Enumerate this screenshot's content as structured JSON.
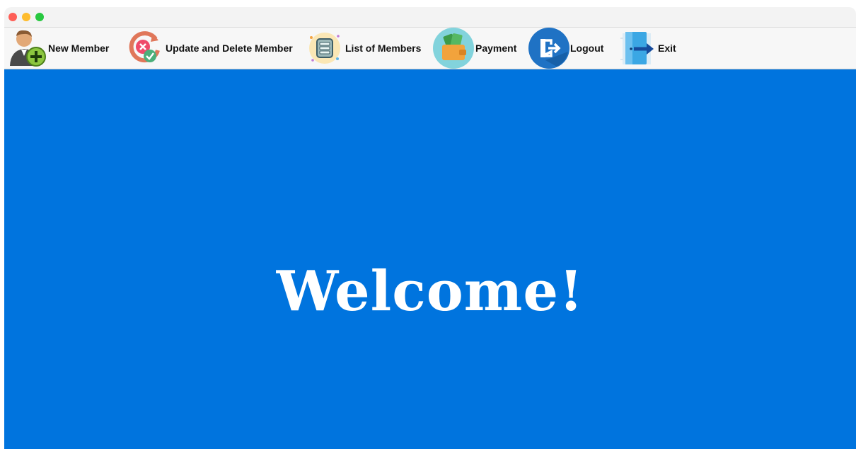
{
  "toolbar": {
    "items": [
      {
        "label": "New Member",
        "icon": "add-user-icon"
      },
      {
        "label": "Update and Delete Member",
        "icon": "update-delete-icon"
      },
      {
        "label": "List of Members",
        "icon": "list-icon"
      },
      {
        "label": "Payment",
        "icon": "wallet-icon"
      },
      {
        "label": "Logout",
        "icon": "logout-icon"
      },
      {
        "label": "Exit",
        "icon": "exit-door-icon"
      }
    ]
  },
  "main": {
    "welcome_text": "Welcome!",
    "background_color": "#0074de"
  }
}
